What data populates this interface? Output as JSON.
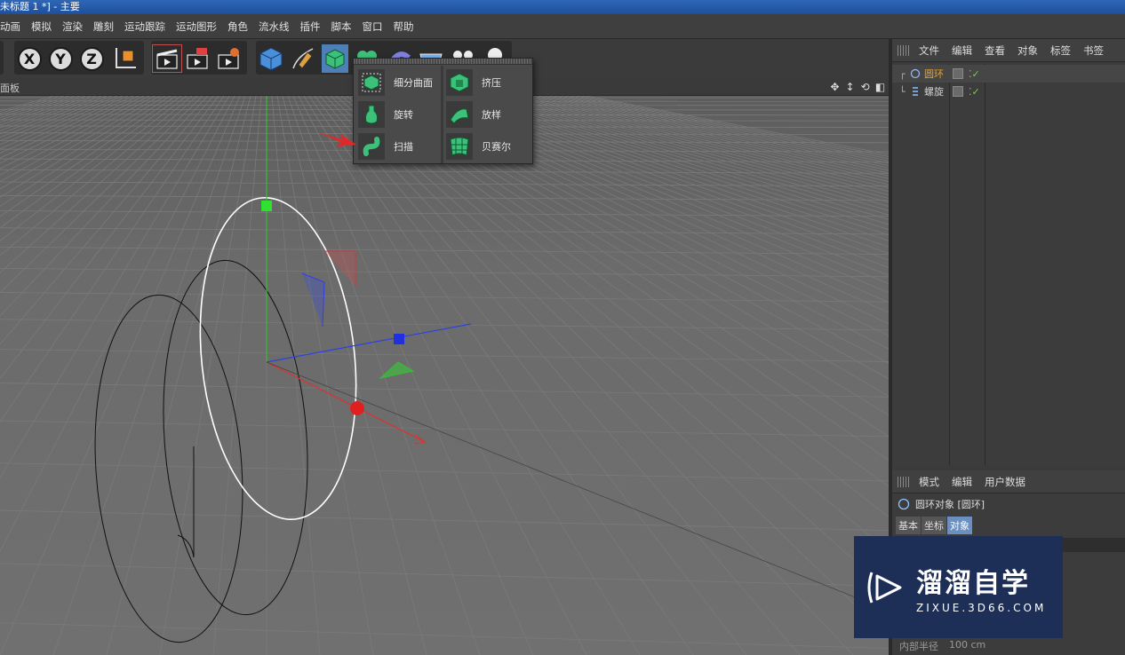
{
  "titlebar": {
    "title": "未标题 1 *] - 主要"
  },
  "menu": [
    "动画",
    "模拟",
    "渲染",
    "雕刻",
    "运动跟踪",
    "运动图形",
    "角色",
    "流水线",
    "插件",
    "脚本",
    "窗口",
    "帮助"
  ],
  "toolbar": {
    "axis_x": "X",
    "axis_y": "Y",
    "axis_z": "Z"
  },
  "viewport": {
    "panel_label": "面板"
  },
  "popup_menu": {
    "items": [
      {
        "label": "细分曲面",
        "icon": "subdivision-surface-icon"
      },
      {
        "label": "挤压",
        "icon": "extrude-icon"
      },
      {
        "label": "旋转",
        "icon": "lathe-icon"
      },
      {
        "label": "放样",
        "icon": "loft-icon"
      },
      {
        "label": "扫描",
        "icon": "sweep-icon"
      },
      {
        "label": "贝赛尔",
        "icon": "bezier-icon"
      }
    ]
  },
  "object_manager": {
    "menu": [
      "文件",
      "编辑",
      "查看",
      "对象",
      "标签",
      "书签"
    ],
    "objects": [
      {
        "name": "圆环",
        "icon": "circle-spline-icon",
        "color": "#f0a020"
      },
      {
        "name": "螺旋",
        "icon": "helix-spline-icon",
        "color": "#cfcfcf"
      }
    ]
  },
  "attribute_manager": {
    "menu": [
      "模式",
      "编辑",
      "用户数据"
    ],
    "object_title": "圆环对象 [圆环]",
    "tabs": [
      "基本",
      "坐标",
      "对象"
    ],
    "active_tab": "对象",
    "field_label": "内部半径",
    "field_value": "100 cm"
  },
  "watermark": {
    "brand": "溜溜自学",
    "url": "ZIXUE.3D66.COM"
  },
  "colors": {
    "x_axis": "#e03030",
    "y_axis": "#30c030",
    "z_axis": "#3040e0",
    "accent": "#f0a020",
    "active_tab": "#6a8fc0"
  }
}
